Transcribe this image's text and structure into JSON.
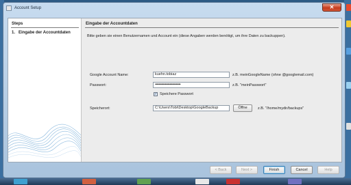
{
  "window": {
    "title": "Account Setup",
    "close_glyph": "✕"
  },
  "steps": {
    "title": "Steps",
    "items": [
      {
        "number": "1.",
        "label": "Eingabe der Accountdaten"
      }
    ]
  },
  "main": {
    "title": "Eingabe der Accountdaten",
    "intro": "Bitte geben sie einen Benutzernamen und Account ein (diese Angaben werden benötigt, um ihre Daten zu backuppen).",
    "account": {
      "label": "Google Account Name:",
      "value": "kuehn.tobiaz",
      "hint": "z.B. meinGoogleName (ohne @googlemail.com)"
    },
    "password": {
      "label": "Passwort:",
      "value": "••••••••••••••••••••••••••••",
      "hint": "z.B. \"meinPasswort\""
    },
    "save_password": {
      "label": "Speichere Passwort",
      "checked": true,
      "check_glyph": "✓"
    },
    "storage": {
      "label": "Speicherort:",
      "value": "C:\\Users\\Tobi\\Desktop\\GoogleBackup",
      "browse_label": "Öffne",
      "hint": "z.B. \"/home/mydir/backups\""
    }
  },
  "buttons": {
    "back": "< Back",
    "next": "Next >",
    "finish": "Finish",
    "cancel": "Cancel",
    "help": "Help"
  },
  "colors": {
    "accent": "#3c7fb1",
    "close": "#c73b1b"
  },
  "icons": [
    "window-app-icon",
    "close-icon",
    "checkbox-check-icon",
    "wave-decoration"
  ]
}
